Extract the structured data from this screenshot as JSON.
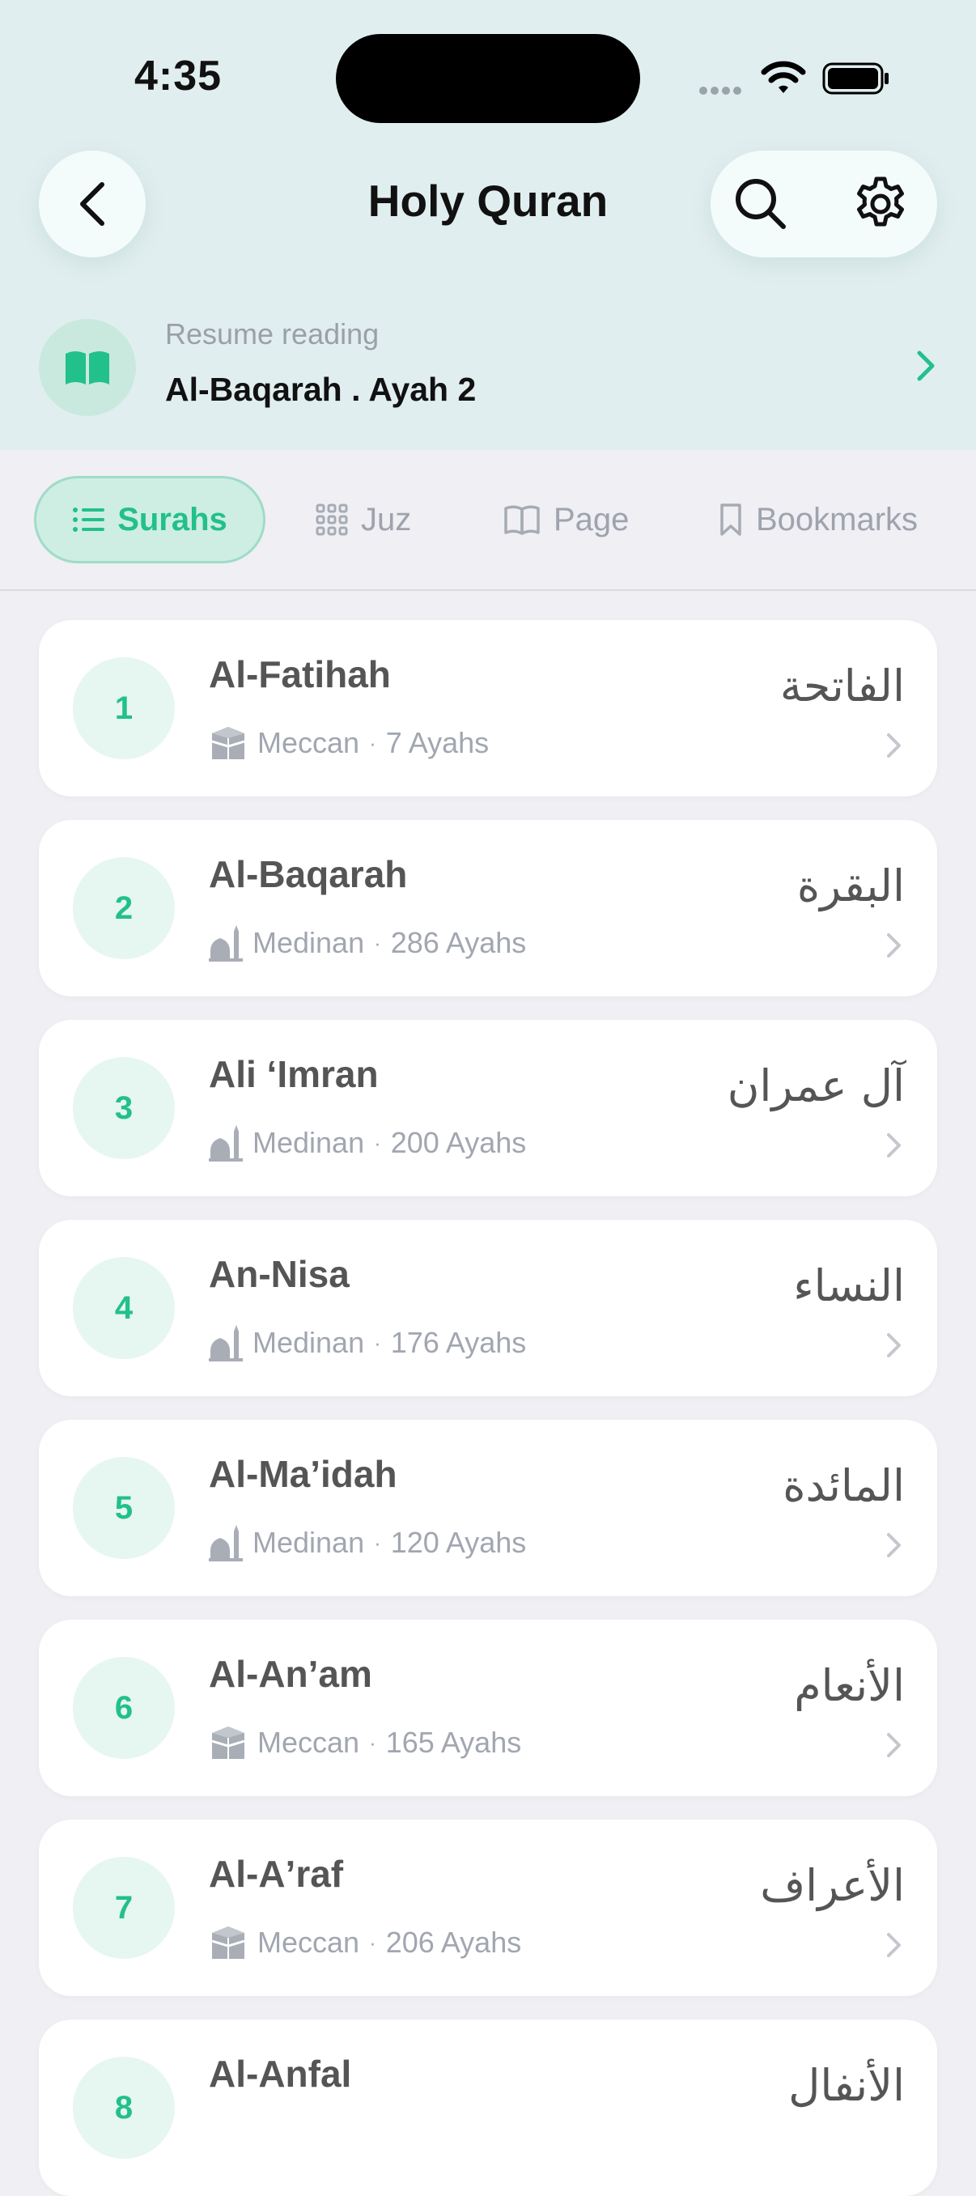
{
  "status_bar": {
    "time": "4:35"
  },
  "header": {
    "title": "Holy Quran"
  },
  "resume": {
    "label": "Resume reading",
    "title": "Al-Baqarah . Ayah 2"
  },
  "tabs": [
    {
      "label": "Surahs",
      "icon": "list-icon",
      "active": true
    },
    {
      "label": "Juz",
      "icon": "grid-icon",
      "active": false
    },
    {
      "label": "Page",
      "icon": "book-icon",
      "active": false
    },
    {
      "label": "Bookmarks",
      "icon": "bookmark-icon",
      "active": false
    }
  ],
  "surahs": [
    {
      "number": "1",
      "name": "Al-Fatihah",
      "type": "Meccan",
      "ayahs": "7 Ayahs",
      "arabic": "الفاتحة"
    },
    {
      "number": "2",
      "name": "Al-Baqarah",
      "type": "Medinan",
      "ayahs": "286 Ayahs",
      "arabic": "البقرة"
    },
    {
      "number": "3",
      "name": "Ali ʻImran",
      "type": "Medinan",
      "ayahs": "200 Ayahs",
      "arabic": "آل عمران"
    },
    {
      "number": "4",
      "name": "An-Nisa",
      "type": "Medinan",
      "ayahs": "176 Ayahs",
      "arabic": "النساء"
    },
    {
      "number": "5",
      "name": "Al-Maʼidah",
      "type": "Medinan",
      "ayahs": "120 Ayahs",
      "arabic": "المائدة"
    },
    {
      "number": "6",
      "name": "Al-Anʼam",
      "type": "Meccan",
      "ayahs": "165 Ayahs",
      "arabic": "الأنعام"
    },
    {
      "number": "7",
      "name": "Al-Aʼraf",
      "type": "Meccan",
      "ayahs": "206 Ayahs",
      "arabic": "الأعراف"
    },
    {
      "number": "8",
      "name": "Al-Anfal",
      "type": "",
      "ayahs": "",
      "arabic": "الأنفال"
    }
  ],
  "colors": {
    "accent": "#22c08a",
    "header_bg": "#e1eeef",
    "page_bg": "#efeff4"
  }
}
